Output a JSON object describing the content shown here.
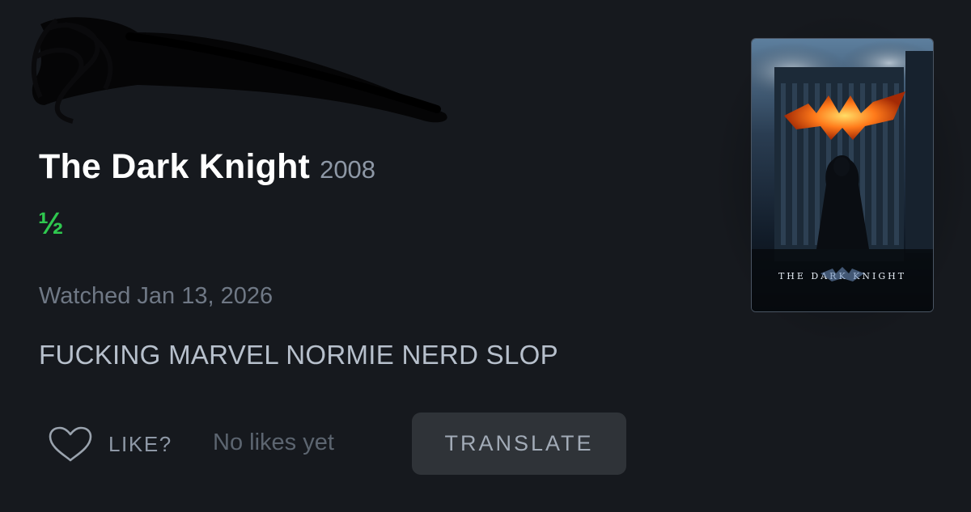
{
  "film": {
    "title": "The Dark Knight",
    "year": "2008",
    "rating": "½",
    "watched": "Watched Jan 13, 2026",
    "review": "FUCKING MARVEL NORMIE NERD SLOP"
  },
  "actions": {
    "like_icon": "heart-icon",
    "like_label": "LIKE?",
    "likes_status": "No likes yet",
    "translate_label": "TRANSLATE"
  },
  "poster": {
    "title_text": "THE DARK KNIGHT"
  },
  "colors": {
    "background": "#16191e",
    "rating_green": "#2fc84f",
    "button_bg": "#2f3338"
  }
}
